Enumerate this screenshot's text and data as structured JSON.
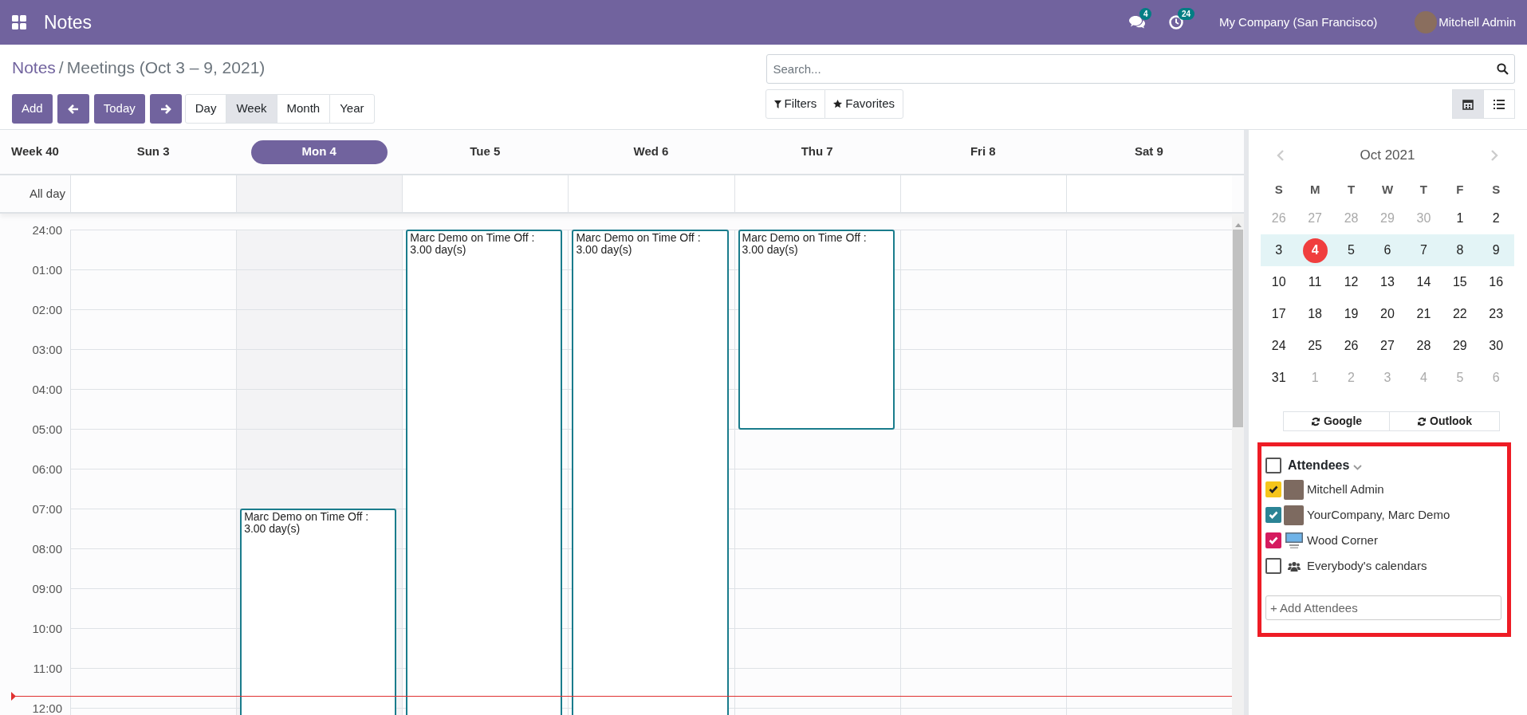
{
  "navbar": {
    "app_title": "Notes",
    "messages_badge": "4",
    "activities_badge": "24",
    "company": "My Company (San Francisco)",
    "user": "Mitchell Admin"
  },
  "breadcrumb": {
    "parent": "Notes",
    "separator": "/",
    "current": "Meetings (Oct 3 – 9, 2021)"
  },
  "buttons": {
    "add": "Add",
    "today": "Today"
  },
  "scales": [
    {
      "label": "Day",
      "selected": false
    },
    {
      "label": "Week",
      "selected": true
    },
    {
      "label": "Month",
      "selected": false
    },
    {
      "label": "Year",
      "selected": false
    }
  ],
  "search": {
    "placeholder": "Search..."
  },
  "filters": [
    {
      "label": "Filters",
      "kind": "filter"
    },
    {
      "label": "Favorites",
      "kind": "star"
    }
  ],
  "views": [
    {
      "kind": "calendar",
      "selected": true
    },
    {
      "kind": "list",
      "selected": false
    }
  ],
  "calendar": {
    "week_label": "Week 40",
    "all_day_label": "All day",
    "days": [
      {
        "label": "Sun 3",
        "selected": false
      },
      {
        "label": "Mon 4",
        "selected": true,
        "events": [
          {
            "title": "Marc Demo on Time Off : 3.00 day(s)"
          }
        ]
      },
      {
        "label": "Tue 5",
        "selected": false,
        "events": [
          {
            "title": "Marc Demo on Time Off : 3.00 day(s)"
          }
        ]
      },
      {
        "label": "Wed 6",
        "selected": false,
        "events": [
          {
            "title": "Marc Demo on Time Off : 3.00 day(s)"
          }
        ]
      },
      {
        "label": "Thu 7",
        "selected": false,
        "events": [
          {
            "title": "Marc Demo on Time Off : 3.00 day(s)"
          }
        ]
      },
      {
        "label": "Fri 8",
        "selected": false
      },
      {
        "label": "Sat 9",
        "selected": false
      }
    ],
    "hours": [
      "24:00",
      "01:00",
      "02:00",
      "03:00",
      "04:00",
      "05:00",
      "06:00",
      "07:00",
      "08:00",
      "09:00",
      "10:00",
      "11:00",
      "12:00"
    ]
  },
  "mini_calendar": {
    "title": "Oct 2021",
    "weekdays": [
      "S",
      "M",
      "T",
      "W",
      "T",
      "F",
      "S"
    ],
    "weeks": [
      {
        "selected": false,
        "days": [
          {
            "label": "26",
            "outside": true,
            "today": false
          },
          {
            "label": "27",
            "outside": true,
            "today": false
          },
          {
            "label": "28",
            "outside": true,
            "today": false
          },
          {
            "label": "29",
            "outside": true,
            "today": false
          },
          {
            "label": "30",
            "outside": true,
            "today": false
          },
          {
            "label": "1",
            "outside": false,
            "today": false
          },
          {
            "label": "2",
            "outside": false,
            "today": false
          }
        ]
      },
      {
        "selected": true,
        "days": [
          {
            "label": "3",
            "outside": false,
            "today": false
          },
          {
            "label": "4",
            "outside": false,
            "today": true
          },
          {
            "label": "5",
            "outside": false,
            "today": false
          },
          {
            "label": "6",
            "outside": false,
            "today": false
          },
          {
            "label": "7",
            "outside": false,
            "today": false
          },
          {
            "label": "8",
            "outside": false,
            "today": false
          },
          {
            "label": "9",
            "outside": false,
            "today": false
          }
        ]
      },
      {
        "selected": false,
        "days": [
          {
            "label": "10",
            "outside": false,
            "today": false
          },
          {
            "label": "11",
            "outside": false,
            "today": false
          },
          {
            "label": "12",
            "outside": false,
            "today": false
          },
          {
            "label": "13",
            "outside": false,
            "today": false
          },
          {
            "label": "14",
            "outside": false,
            "today": false
          },
          {
            "label": "15",
            "outside": false,
            "today": false
          },
          {
            "label": "16",
            "outside": false,
            "today": false
          }
        ]
      },
      {
        "selected": false,
        "days": [
          {
            "label": "17",
            "outside": false,
            "today": false
          },
          {
            "label": "18",
            "outside": false,
            "today": false
          },
          {
            "label": "19",
            "outside": false,
            "today": false
          },
          {
            "label": "20",
            "outside": false,
            "today": false
          },
          {
            "label": "21",
            "outside": false,
            "today": false
          },
          {
            "label": "22",
            "outside": false,
            "today": false
          },
          {
            "label": "23",
            "outside": false,
            "today": false
          }
        ]
      },
      {
        "selected": false,
        "days": [
          {
            "label": "24",
            "outside": false,
            "today": false
          },
          {
            "label": "25",
            "outside": false,
            "today": false
          },
          {
            "label": "26",
            "outside": false,
            "today": false
          },
          {
            "label": "27",
            "outside": false,
            "today": false
          },
          {
            "label": "28",
            "outside": false,
            "today": false
          },
          {
            "label": "29",
            "outside": false,
            "today": false
          },
          {
            "label": "30",
            "outside": false,
            "today": false
          }
        ]
      },
      {
        "selected": false,
        "days": [
          {
            "label": "31",
            "outside": false,
            "today": false
          },
          {
            "label": "1",
            "outside": true,
            "today": false
          },
          {
            "label": "2",
            "outside": true,
            "today": false
          },
          {
            "label": "3",
            "outside": true,
            "today": false
          },
          {
            "label": "4",
            "outside": true,
            "today": false
          },
          {
            "label": "5",
            "outside": true,
            "today": false
          },
          {
            "label": "6",
            "outside": true,
            "today": false
          }
        ]
      }
    ]
  },
  "sync_buttons": [
    {
      "label": "Google"
    },
    {
      "label": "Outlook"
    }
  ],
  "attendees": {
    "label": "Attendees",
    "checked": false,
    "add_placeholder": "+ Add Attendees",
    "items": [
      {
        "label": "Mitchell Admin",
        "checked": true,
        "color": "#f5c51b",
        "kind": "photo"
      },
      {
        "label": "YourCompany, Marc Demo",
        "checked": true,
        "color": "#2b8495",
        "kind": "photo"
      },
      {
        "label": "Wood Corner",
        "checked": true,
        "color": "#d51b5f",
        "kind": "logo"
      },
      {
        "label": "Everybody's calendars",
        "checked": false,
        "kind": "group"
      }
    ]
  }
}
